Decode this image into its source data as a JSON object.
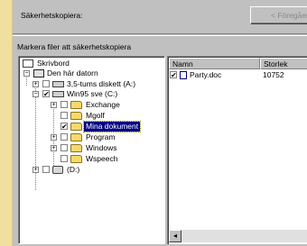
{
  "app": {
    "title": "Säkerhetskopiera:"
  },
  "toolbar": {
    "prev_label": "< Föregående"
  },
  "prompt": "Markera filer att säkerhetskopiera",
  "tree": {
    "items": [
      {
        "label": "Skrivbord"
      },
      {
        "label": "Den här datorn"
      },
      {
        "label": "3,5-tums diskett (A:)"
      },
      {
        "label": "Win95 sve (C:)"
      },
      {
        "label": "Exchange"
      },
      {
        "label": "Mgolf"
      },
      {
        "label": "Mina dokument"
      },
      {
        "label": "Program"
      },
      {
        "label": "Windows"
      },
      {
        "label": "Wspeech"
      },
      {
        "label": "(D:)"
      }
    ]
  },
  "list": {
    "columns": [
      "Namn",
      "Storlek"
    ],
    "rows": [
      {
        "name": "Party.doc",
        "size": "10752"
      }
    ]
  },
  "glyphs": {
    "check": "✔",
    "plus": "+",
    "minus": "−",
    "left_arrow": "◂"
  }
}
